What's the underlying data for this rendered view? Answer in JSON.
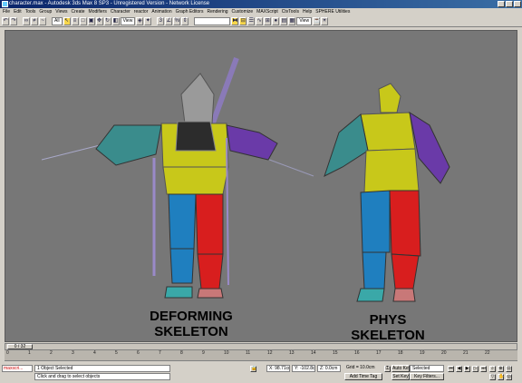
{
  "window": {
    "title": "character.max - Autodesk 3ds Max 8 SP3 - Unregistered Version - Network License"
  },
  "menu": [
    "File",
    "Edit",
    "Tools",
    "Group",
    "Views",
    "Create",
    "Modifiers",
    "Character",
    "reactor",
    "Animation",
    "Graph Editors",
    "Rendering",
    "Customize",
    "MAXScript",
    "CtvTools",
    "Help",
    "SPHERE Utilities"
  ],
  "toolbar": {
    "selection_filter": "All",
    "ref_coord": "View",
    "named_selection": "View"
  },
  "viewport": {
    "captions": {
      "deforming": [
        "DEFORMING",
        "SKELETON"
      ],
      "phys": [
        "PHYS",
        "SKELETON"
      ]
    },
    "colors": {
      "background": "#777777",
      "blue": "#1f7fbf",
      "red": "#d81e1e",
      "yellow": "#c8c81a",
      "purple": "#6a3aa8",
      "teal": "#3a8c8c",
      "grey": "#a8a8a8"
    }
  },
  "timeline": {
    "frame_indicator": "0 / 32",
    "ticks": [
      "0",
      "1",
      "2",
      "3",
      "4",
      "5",
      "6",
      "7",
      "8",
      "9",
      "10",
      "11",
      "12",
      "13",
      "14",
      "15",
      "16",
      "17",
      "18",
      "19",
      "20",
      "21",
      "22"
    ]
  },
  "status": {
    "maxscript": "maxscri...",
    "selection": "1 Object Selected",
    "prompt": "Click and drag to select objects",
    "x": "X: 98.71cm",
    "y": "Y: -102.8cm",
    "z": "Z: 0.0cm",
    "grid": "Grid = 10.0cm",
    "add_time_tag": "Add Time Tag",
    "auto_key": "Auto Key",
    "set_key": "Set Key",
    "key_mode": "Selected",
    "key_filters": "Key Filters..."
  }
}
